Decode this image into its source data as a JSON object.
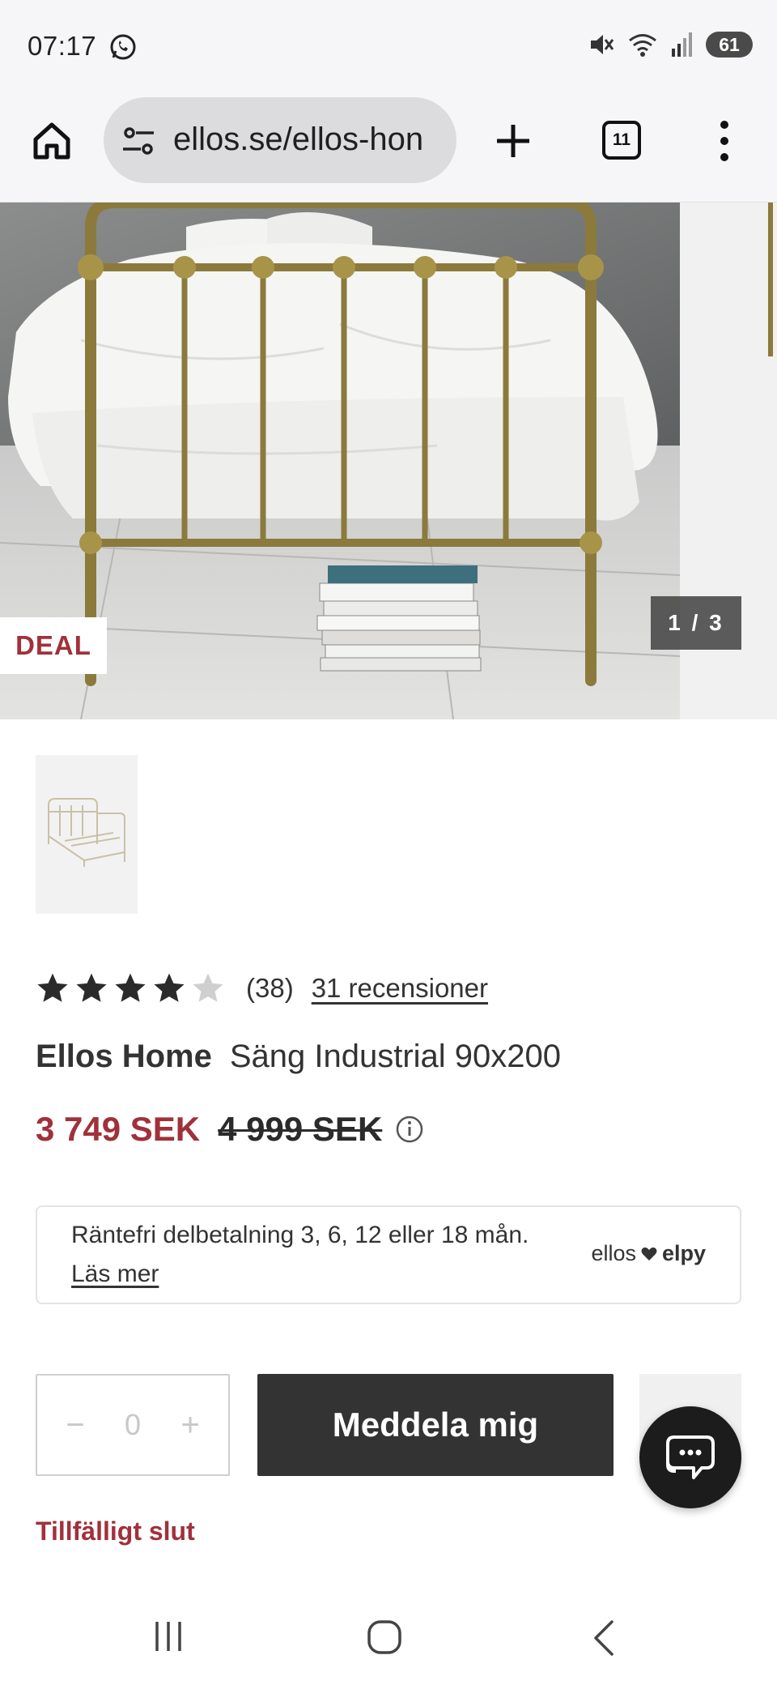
{
  "status_bar": {
    "time": "07:17",
    "battery": "61",
    "icons": [
      "whatsapp-icon",
      "mute-icon",
      "wifi-icon",
      "signal-icon",
      "battery-icon"
    ]
  },
  "browser": {
    "url": "ellos.se/ellos-hon",
    "tab_count": "11",
    "icons": [
      "home-icon",
      "site-settings-icon",
      "plus-icon",
      "tabs-icon",
      "more-vertical-icon"
    ]
  },
  "gallery": {
    "badge": "DEAL",
    "counter": "1 / 3"
  },
  "product": {
    "rating_value": 3.9,
    "rating_max": 5,
    "rating_count": "(38)",
    "reviews_link": "31 recensioner",
    "brand": "Ellos Home",
    "name": "Säng Industrial 90x200",
    "price_now": "3 749 SEK",
    "price_old": "4 999 SEK"
  },
  "financing": {
    "text": "Räntefri delbetalning 3, 6, 12 eller 18 mån.",
    "link": "Läs mer",
    "logo_left": "ellos",
    "logo_right": "elpy"
  },
  "purchase": {
    "qty_minus": "−",
    "qty_value": "0",
    "qty_plus": "+",
    "notify_label": "Meddela mig",
    "stock_status": "Tillfälligt slut"
  },
  "colors": {
    "accent": "#a0313a",
    "button_dark": "#333333",
    "chrome_bg": "#f6f6f9"
  }
}
